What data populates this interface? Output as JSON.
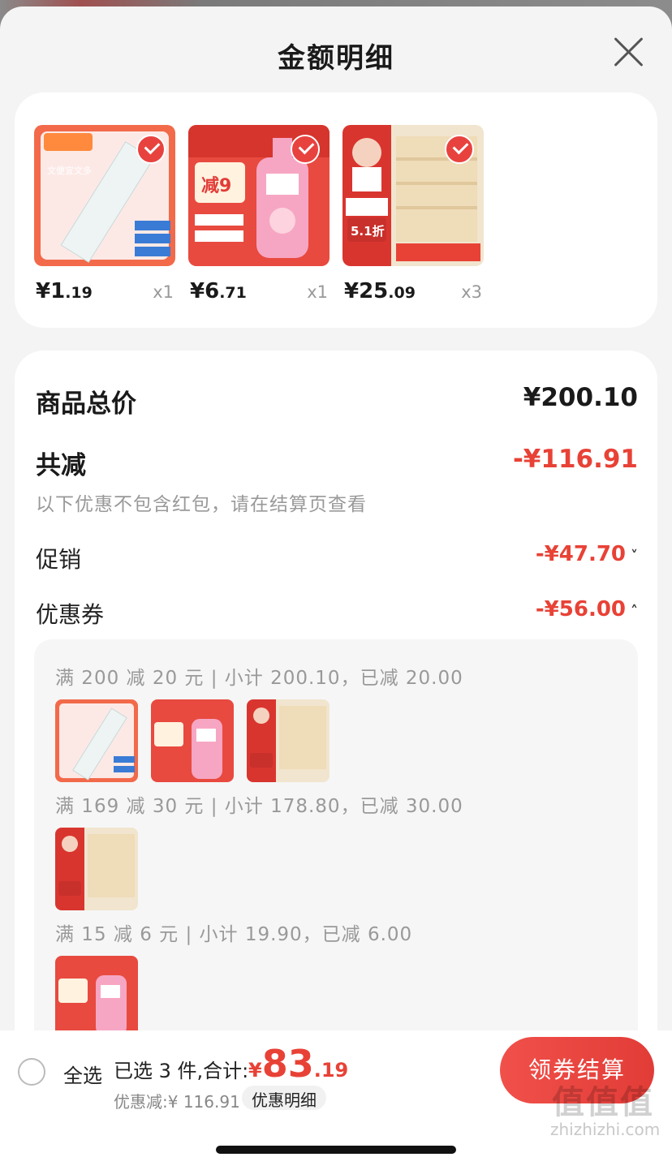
{
  "header": {
    "title": "金额明细"
  },
  "products": [
    {
      "price_int": "¥1",
      "price_dec": ".19",
      "qty": "x1",
      "thumb_label": "文便宜文多"
    },
    {
      "price_int": "¥6",
      "price_dec": ".71",
      "qty": "x1",
      "thumb_label": "减9"
    },
    {
      "price_int": "¥25",
      "price_dec": ".09",
      "qty": "x3",
      "thumb_label": "5.1折"
    }
  ],
  "summary": {
    "total_label": "商品总价",
    "total_value": "¥200.10",
    "reduce_label": "共减",
    "reduce_value": "-¥116.91",
    "note": "以下优惠不包含红包，请在结算页查看",
    "promo_label": "促销",
    "promo_value": "-¥47.70",
    "coupon_label": "优惠券",
    "coupon_value": "-¥56.00"
  },
  "coupons": [
    {
      "text": "满 200 减 20 元 | 小计 200.10，已减 20.00"
    },
    {
      "text": "满 169 减 30 元 | 小计 178.80，已减 30.00"
    },
    {
      "text": "满 15 减 6 元 | 小计 19.90，已减 6.00"
    }
  ],
  "bottom": {
    "select_all": "全选",
    "selected": "已选 3 件,合计:",
    "yen": "¥",
    "amount_int": "83",
    "amount_dec": ".19",
    "discount": "优惠减:¥ 116.91",
    "detail_link": "优惠明细",
    "checkout": "领券结算"
  },
  "watermark": {
    "text": "值值值",
    "url": "zhizhizhi.com"
  },
  "colors": {
    "accent": "#e84236",
    "button": "#e23c37"
  }
}
